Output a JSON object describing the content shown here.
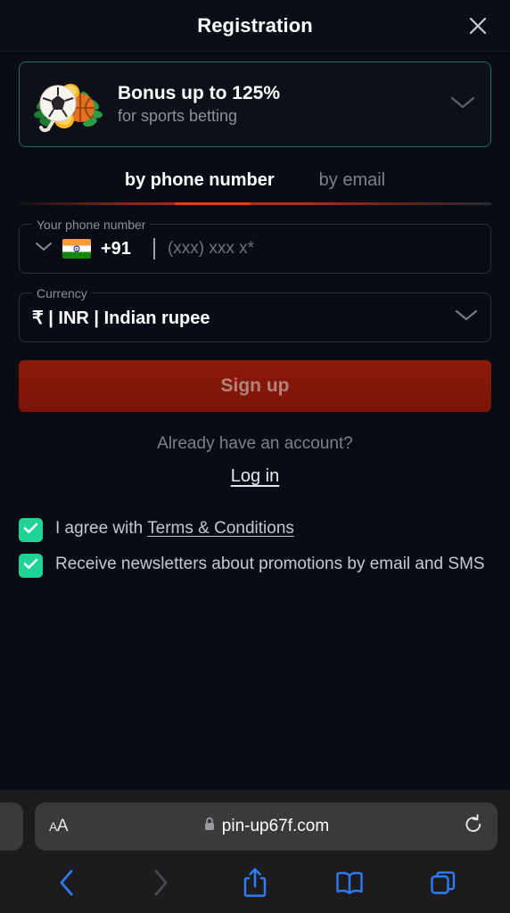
{
  "modal": {
    "title": "Registration",
    "close_icon": "close-icon"
  },
  "bonus_banner": {
    "title": "Bonus up to 125%",
    "subtitle": "for sports betting",
    "art_icon": "sports-bonus-icon",
    "expand_icon": "chevron-down-icon",
    "border_color": "#1d6d5b"
  },
  "tabs": [
    {
      "label": "by phone number",
      "active": true
    },
    {
      "label": "by email",
      "active": false
    }
  ],
  "tab_accent_color": "#ef3b15",
  "phone_field": {
    "legend": "Your phone number",
    "country_chevron_icon": "chevron-down-icon",
    "flag_icon": "india-flag-icon",
    "country_code": "+91",
    "value": "",
    "placeholder": "(xxx) xxx x*"
  },
  "currency_field": {
    "legend": "Currency",
    "value": "₹ | INR | Indian rupee",
    "chevron_icon": "chevron-down-icon"
  },
  "signup": {
    "label": "Sign up",
    "background_color": "#7d1609",
    "text_color": "#b4827a"
  },
  "login": {
    "prompt": "Already have an account?",
    "link_label": "Log in"
  },
  "checkboxes": [
    {
      "checked": true,
      "text_before": "I agree with ",
      "link_label": "Terms & Conditions",
      "text_after": ""
    },
    {
      "checked": true,
      "text_before": "Receive newsletters about promotions by email and SMS",
      "link_label": "",
      "text_after": ""
    }
  ],
  "checkbox_color": "#1fd295",
  "browser": {
    "text_size_label_small": "A",
    "text_size_label_large": "A",
    "lock_icon": "lock-icon",
    "url": "pin-up67f.com",
    "reload_icon": "reload-icon",
    "nav": [
      {
        "name": "back-button",
        "icon": "chevron-left-icon",
        "enabled": true
      },
      {
        "name": "forward-button",
        "icon": "chevron-right-icon",
        "enabled": false
      },
      {
        "name": "share-button",
        "icon": "share-icon",
        "enabled": true
      },
      {
        "name": "bookmarks-button",
        "icon": "book-icon",
        "enabled": true
      },
      {
        "name": "tabs-button",
        "icon": "tabs-icon",
        "enabled": true
      }
    ],
    "accent_color": "#2f7cf6"
  }
}
